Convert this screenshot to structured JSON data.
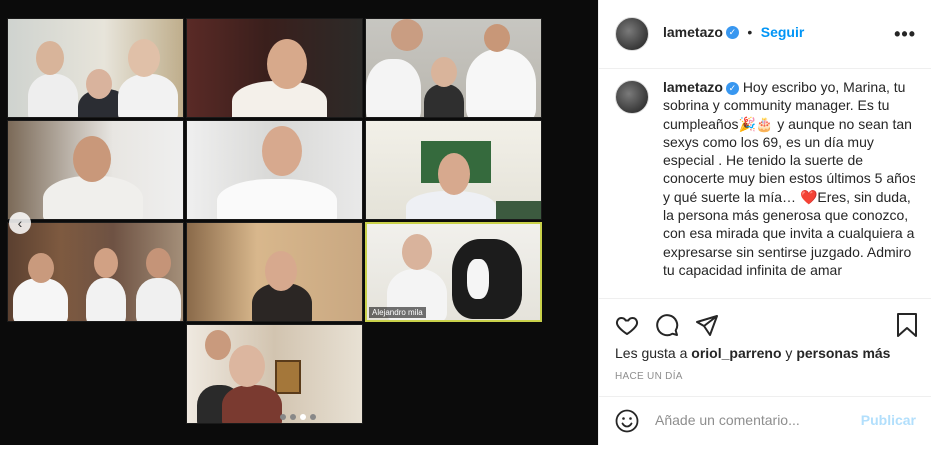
{
  "post": {
    "username": "lametazo",
    "follow_label": "Seguir",
    "more_label": "•••",
    "caption_username": "lametazo",
    "caption_text": "Hoy escribo yo, Marina, tu sobrina y community manager. Es tu cumpleaños🎉🎂 y aunque no sean tan sexys como los 69, es un día muy especial . He tenido la suerte de conocerte muy bien estos últimos 5 años, y qué suerte la mía… ❤️Eres, sin duda, la persona más generosa que conozco, con esa mirada que invita a cualquiera a expresarse sin sentirse juzgado. Admiro tu capacidad infinita de amar",
    "likes_prefix": "Les gusta a",
    "likes_user": "oriol_parreno",
    "likes_connector": "y",
    "likes_suffix": "personas más",
    "time_ago": "HACE UN DÍA",
    "comment_placeholder": "Añade un comentario...",
    "publish_label": "Publicar"
  },
  "media": {
    "tile_label": "Alejandro mila",
    "carousel_total": 4,
    "carousel_active": 3
  },
  "icons": {
    "verified": "verified-badge-icon",
    "like": "heart-icon",
    "comment": "comment-icon",
    "share": "paper-plane-icon",
    "save": "bookmark-icon",
    "emoji": "smiley-icon",
    "prev": "chevron-left-icon"
  },
  "colors": {
    "accent": "#0095f6",
    "verified": "#3897f0",
    "publish_disabled": "#b2dffc",
    "active_tile_border": "#c9d14a"
  }
}
